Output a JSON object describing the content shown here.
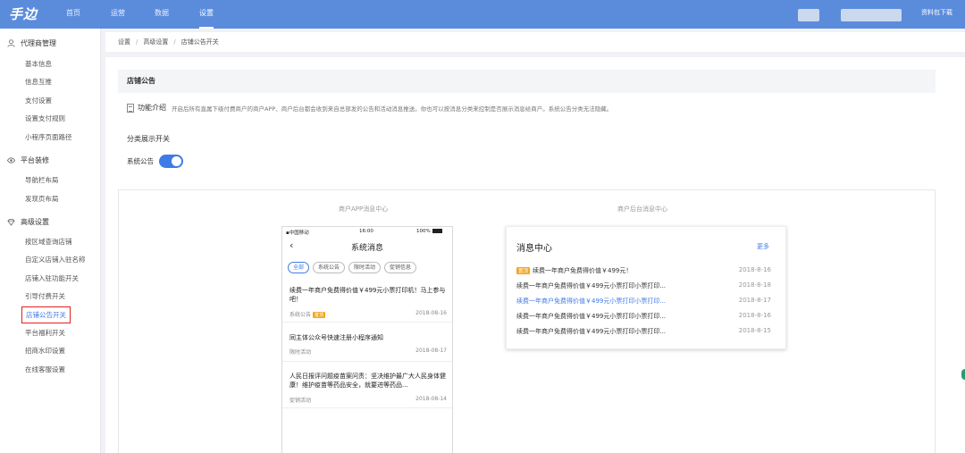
{
  "brand": {
    "logo": "手边",
    "accent": "#5b8cdc",
    "link_blue": "#3f7be8",
    "selected_border": "#e02020"
  },
  "topnav": {
    "items": [
      "首页",
      "运营",
      "数据",
      "设置"
    ],
    "active": "设置",
    "download": "资料包下载"
  },
  "sidebar": {
    "groups": [
      {
        "label": "代理商管理",
        "icon": "user-icon",
        "items": [
          "基本信息",
          "信息互推",
          "支付设置",
          "设置支付规则",
          "小程序页面路径"
        ]
      },
      {
        "label": "平台装修",
        "icon": "eye-icon",
        "items": [
          "导航栏布局",
          "发现页布局"
        ]
      },
      {
        "label": "高级设置",
        "icon": "diamond-icon",
        "items": [
          "按区域查询店铺",
          "自定义店铺入驻名称",
          "店铺入驻功能开关",
          "引导付费开关",
          "店铺公告开关",
          "平台福利开关",
          "招商水印设置",
          "在线客服设置"
        ]
      }
    ],
    "selected": "店铺公告开关"
  },
  "breadcrumb": [
    "设置",
    "高级设置",
    "店铺公告开关"
  ],
  "page": {
    "section_title": "店铺公告",
    "intro_title": "功能介绍",
    "intro_text": "开启后所有直属下级付费商户的商户APP、商户后台都会收到来自总部发的公告和活动消息推送。你也可以按消息分类来控制是否展示消息给商户。系统公告分类无法隐藏。",
    "switch_title": "分类展示开关",
    "switch_label": "系统公告",
    "switch_on": true
  },
  "preview": {
    "app_label": "商户APP消息中心",
    "admin_label": "商户后台消息中心",
    "phone": {
      "carrier": "中国移动",
      "time": "16:00",
      "battery": "100%",
      "title": "系统消息",
      "back": "‹",
      "chips": [
        "全部",
        "系统公告",
        "限时活动",
        "促销信息"
      ],
      "active_chip": "全部",
      "items": [
        {
          "title": "续费一年商户免费得价值￥499元小票打印机！马上参与吧！",
          "category": "系统公告",
          "tag": "置顶",
          "date": "2018-08-16"
        },
        {
          "title": "同主体公众号快速注册小程序通知",
          "category": "限时活动",
          "tag": "",
          "date": "2018-08-17"
        },
        {
          "title": "人民日报评问题疫苗案问责：坚决维护最广大人民身体健康！维护疫苗等药品安全，就要进等药品...",
          "category": "促销活动",
          "tag": "",
          "date": "2018-08-14"
        }
      ]
    },
    "admin": {
      "title": "消息中心",
      "more": "更多",
      "rows": [
        {
          "badge": "置顶",
          "text": "续费一年商户免费得价值￥499元！",
          "date": "2018-8-16",
          "link": false
        },
        {
          "badge": "",
          "text": "续费一年商户免费得价值￥499元小票打印小票打印...",
          "date": "2018-8-18",
          "link": false
        },
        {
          "badge": "",
          "text": "续费一年商户免费得价值￥499元小票打印小票打印...",
          "date": "2018-8-17",
          "link": true
        },
        {
          "badge": "",
          "text": "续费一年商户免费得价值￥499元小票打印小票打印...",
          "date": "2018-8-16",
          "link": false
        },
        {
          "badge": "",
          "text": "续费一年商户免费得价值￥499元小票打印小票打印...",
          "date": "2018-8-15",
          "link": false
        }
      ]
    }
  }
}
